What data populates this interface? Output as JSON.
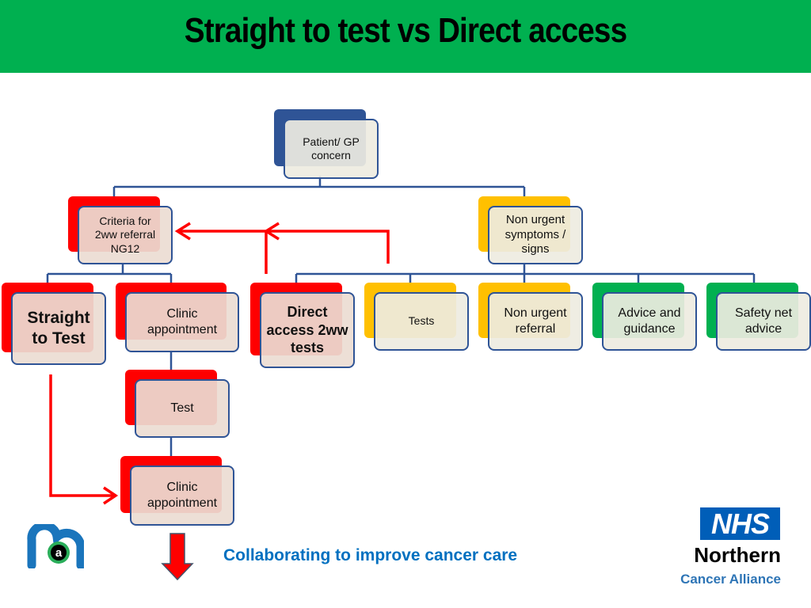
{
  "header": {
    "title": "Straight to test  vs Direct access",
    "background_color": "#00b050"
  },
  "diagram": {
    "root": {
      "label": "Patient/ GP concern",
      "color": "navy"
    },
    "level1": [
      {
        "id": "criteria",
        "label": "Criteria for 2ww referral NG12",
        "color": "red"
      },
      {
        "id": "non-urgent-symptoms",
        "label": "Non urgent symptoms / signs",
        "color": "yellow"
      }
    ],
    "level2": [
      {
        "id": "straight-to-test",
        "label": "Straight to Test",
        "color": "red",
        "bold": true,
        "parent": "criteria"
      },
      {
        "id": "clinic-appointment",
        "label": "Clinic appointment",
        "color": "red",
        "parent": "criteria"
      },
      {
        "id": "direct-access",
        "label": "Direct access 2ww tests",
        "color": "red",
        "bold": true,
        "parent": "non-urgent-symptoms"
      },
      {
        "id": "tests",
        "label": "Tests",
        "color": "yellow",
        "parent": "non-urgent-symptoms"
      },
      {
        "id": "non-urgent-referral",
        "label": "Non urgent referral",
        "color": "yellow",
        "parent": "non-urgent-symptoms"
      },
      {
        "id": "advice-guidance",
        "label": "Advice and guidance",
        "color": "green",
        "parent": "non-urgent-symptoms"
      },
      {
        "id": "safety-net",
        "label": "Safety net advice",
        "color": "green",
        "parent": "non-urgent-symptoms"
      }
    ],
    "level3": [
      {
        "id": "test",
        "label": "Test",
        "color": "red",
        "parent": "clinic-appointment"
      },
      {
        "id": "clinic-appointment-2",
        "label": "Clinic appointment",
        "color": "red",
        "parent": "test"
      }
    ],
    "arrows": [
      {
        "from": "direct-access",
        "to": "criteria",
        "color": "#ff0000"
      },
      {
        "from": "non-urgent-symptoms-branch",
        "to": "criteria",
        "color": "#ff0000"
      },
      {
        "from": "straight-to-test",
        "to": "clinic-appointment-2",
        "color": "#ff0000"
      }
    ],
    "colors": {
      "red": "#ff0000",
      "yellow": "#ffc000",
      "green": "#00b050",
      "navy": "#2f5496",
      "connector": "#2f5496"
    }
  },
  "footer": {
    "tagline": "Collaborating to improve cancer care",
    "tagline_color": "#0070c0",
    "logo_left": "nca-logo",
    "nhs_badge": "NHS",
    "nhs_name": "Northern",
    "nhs_subtitle": "Cancer Alliance"
  }
}
